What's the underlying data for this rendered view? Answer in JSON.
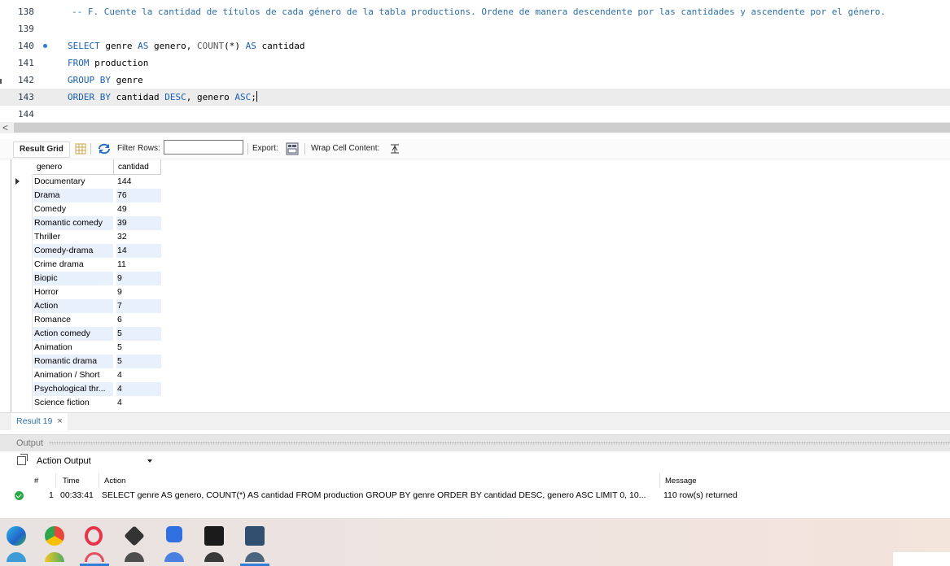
{
  "editor": {
    "lines": [
      {
        "num": "138",
        "type": "comment",
        "text": "-- F. Cuente la cantidad de títulos de cada género de la tabla productions. Ordene de manera descendente por las cantidades y ascendente por el género."
      },
      {
        "num": "139",
        "type": "blank",
        "text": ""
      },
      {
        "num": "140",
        "type": "code",
        "tokens": [
          [
            "kw",
            "SELECT"
          ],
          [
            "t",
            " genre "
          ],
          [
            "kw",
            "AS"
          ],
          [
            "t",
            " genero, "
          ],
          [
            "fn",
            "COUNT"
          ],
          [
            "t",
            "(*) "
          ],
          [
            "kw",
            "AS"
          ],
          [
            "t",
            " cantidad"
          ]
        ]
      },
      {
        "num": "141",
        "type": "code",
        "tokens": [
          [
            "kw",
            "FROM"
          ],
          [
            "t",
            " production"
          ]
        ]
      },
      {
        "num": "142",
        "type": "code",
        "tokens": [
          [
            "kw",
            "GROUP BY"
          ],
          [
            "t",
            " genre"
          ]
        ]
      },
      {
        "num": "143",
        "type": "code",
        "tokens": [
          [
            "kw",
            "ORDER BY"
          ],
          [
            "t",
            " cantidad "
          ],
          [
            "kw",
            "DESC"
          ],
          [
            "t",
            ", genero "
          ],
          [
            "kw",
            "ASC"
          ],
          [
            "t",
            ";"
          ]
        ]
      },
      {
        "num": "144",
        "type": "blank",
        "text": ""
      }
    ],
    "breakpoint_line": "140",
    "current_line": "143"
  },
  "toolbar": {
    "result_grid": "Result Grid",
    "filter_rows": "Filter Rows:",
    "filter_value": "",
    "export": "Export:",
    "wrap": "Wrap Cell Content:"
  },
  "grid": {
    "columns": [
      "genero",
      "cantidad"
    ],
    "rows": [
      [
        "Documentary",
        "144"
      ],
      [
        "Drama",
        "76"
      ],
      [
        "Comedy",
        "49"
      ],
      [
        "Romantic comedy",
        "39"
      ],
      [
        "Thriller",
        "32"
      ],
      [
        "Comedy-drama",
        "14"
      ],
      [
        "Crime drama",
        "11"
      ],
      [
        "Biopic",
        "9"
      ],
      [
        "Horror",
        "9"
      ],
      [
        "Action",
        "7"
      ],
      [
        "Romance",
        "6"
      ],
      [
        "Action comedy",
        "5"
      ],
      [
        "Animation",
        "5"
      ],
      [
        "Romantic drama",
        "5"
      ],
      [
        "Animation / Short",
        "4"
      ],
      [
        "Psychological thr...",
        "4"
      ],
      [
        "Science fiction",
        "4"
      ]
    ]
  },
  "result_tab": {
    "label": "Result 19",
    "close": "×"
  },
  "output": {
    "title": "Output",
    "selector": "Action Output",
    "headers": {
      "num": "#",
      "time": "Time",
      "action": "Action",
      "message": "Message"
    },
    "row": {
      "num": "1",
      "time": "00:33:41",
      "action": "SELECT genre AS genero, COUNT(*) AS cantidad FROM production GROUP BY genre ORDER BY cantidad DESC, genero ASC LIMIT 0, 10...",
      "message": "110 row(s) returned",
      "status": "success"
    }
  },
  "taskbar": {
    "apps": [
      {
        "icon": "edge-icon",
        "color": "#1f8fd6",
        "active": false
      },
      {
        "icon": "chrome-icon",
        "color": "#e8453c",
        "active": false
      },
      {
        "icon": "opera-icon",
        "color": "#e8344a",
        "active": true
      },
      {
        "icon": "inkscape-icon",
        "color": "#333333",
        "active": false
      },
      {
        "icon": "c-app-icon",
        "color": "#2f6fe0",
        "active": false
      },
      {
        "icon": "terminal-icon",
        "color": "#1b1b1b",
        "active": false
      },
      {
        "icon": "mysql-workbench-icon",
        "color": "#31506f",
        "active": true
      }
    ]
  },
  "colors": {
    "keyword": "#1a5fb4",
    "comment": "#2f6fa8",
    "row_alt": "#e8f0fb",
    "success": "#2aa845"
  }
}
